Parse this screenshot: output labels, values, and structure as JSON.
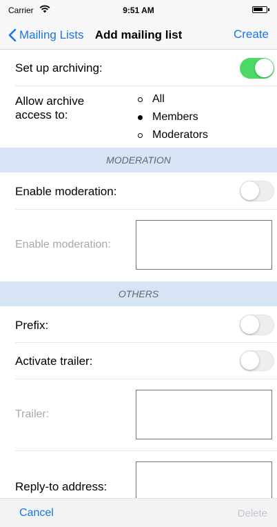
{
  "status_bar": {
    "carrier": "Carrier",
    "time": "9:51 AM"
  },
  "nav": {
    "back_label": "Mailing Lists",
    "title": "Add mailing list",
    "create_label": "Create"
  },
  "archiving": {
    "label": "Set up archiving:",
    "enabled": true
  },
  "archive_access": {
    "label_line1": "Allow archive",
    "label_line2": "access to:",
    "options": [
      "All",
      "Members",
      "Moderators"
    ],
    "selected": "Members"
  },
  "moderation_section": {
    "header": "MODERATION",
    "enable_label": "Enable moderation:",
    "enabled": false,
    "text_label": "Enable moderation:",
    "text_value": ""
  },
  "others_section": {
    "header": "OTHERS",
    "prefix_label": "Prefix:",
    "prefix_enabled": false,
    "trailer_toggle_label": "Activate trailer:",
    "trailer_enabled": false,
    "trailer_label": "Trailer:",
    "trailer_value": "",
    "reply_to_label": "Reply-to address:",
    "reply_to_value": ""
  },
  "toolbar": {
    "cancel_label": "Cancel",
    "delete_label": "Delete"
  },
  "colors": {
    "accent": "#1a73e8",
    "toggle_on": "#4cd964",
    "section_header_bg": "#d6e4f5"
  }
}
